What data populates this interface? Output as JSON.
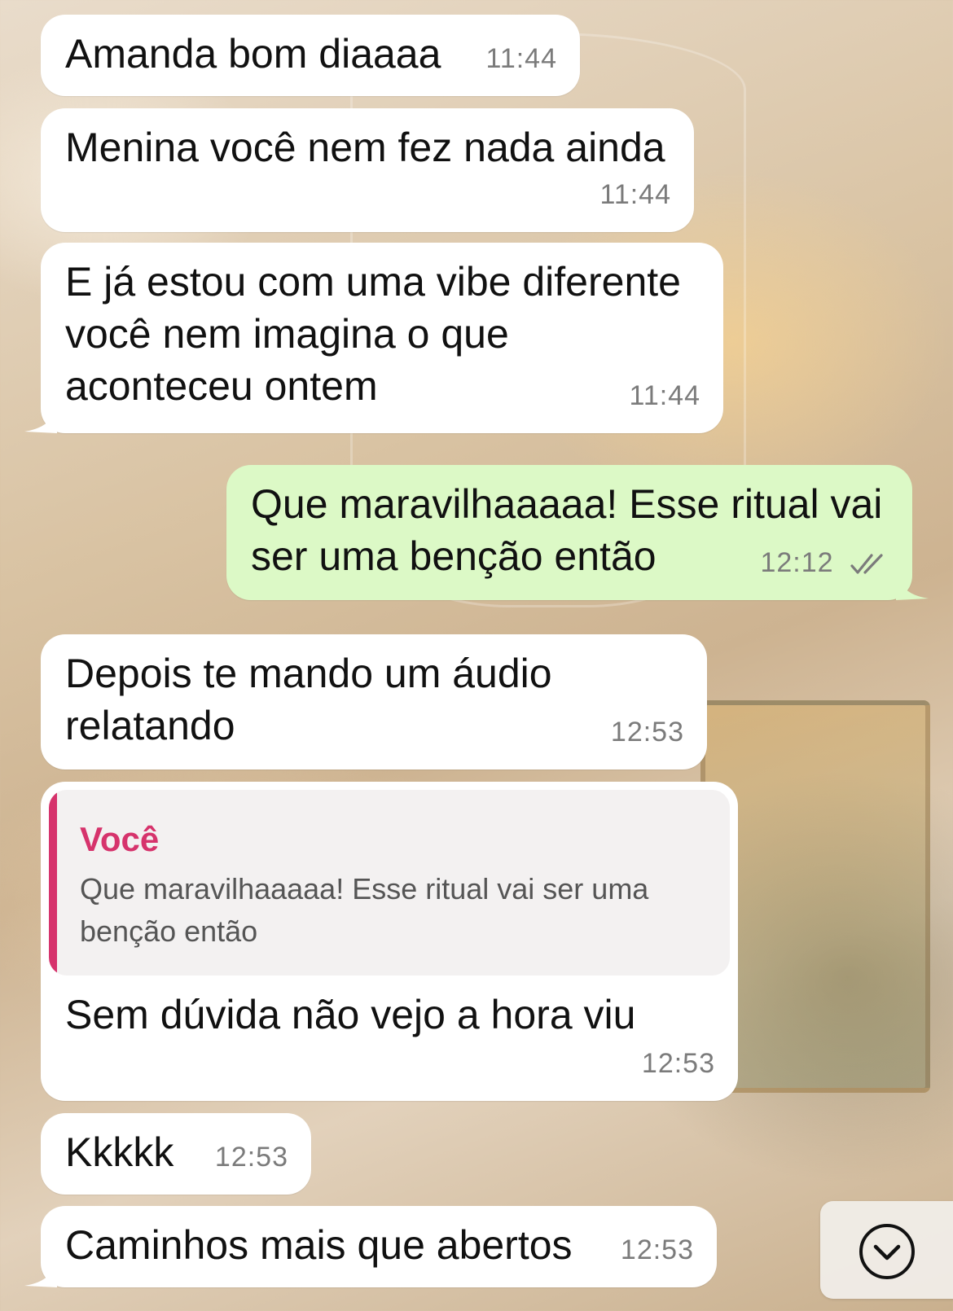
{
  "messages": [
    {
      "direction": "incoming",
      "text": "Amanda bom diaaaa",
      "time": "11:44"
    },
    {
      "direction": "incoming",
      "text": "Menina você nem fez nada ainda",
      "time": "11:44"
    },
    {
      "direction": "incoming",
      "text": "E já estou com uma vibe diferente você nem imagina o que aconteceu ontem",
      "time": "11:44"
    },
    {
      "direction": "outgoing",
      "text": "Que maravilhaaaaa! Esse ritual vai ser uma benção então",
      "time": "12:12",
      "status": "read"
    },
    {
      "direction": "incoming",
      "text": "Depois te mando um áudio relatando",
      "time": "12:53"
    },
    {
      "direction": "incoming",
      "text": "Sem dúvida não vejo a hora viu",
      "time": "12:53",
      "reply": {
        "author": "Você",
        "text": "Que maravilhaaaaa! Esse ritual vai ser uma benção então"
      }
    },
    {
      "direction": "incoming",
      "text": "Kkkkk",
      "time": "12:53"
    },
    {
      "direction": "incoming",
      "text": "Caminhos mais que abertos",
      "time": "12:53"
    }
  ],
  "icons": {
    "read_receipt": "double-check-icon",
    "scroll_down": "chevron-down-circle-icon"
  },
  "colors": {
    "incoming_bubble": "#ffffff",
    "outgoing_bubble": "#dcf9c6",
    "reply_accent": "#d6336c",
    "timestamp": "#7b7b7b"
  }
}
